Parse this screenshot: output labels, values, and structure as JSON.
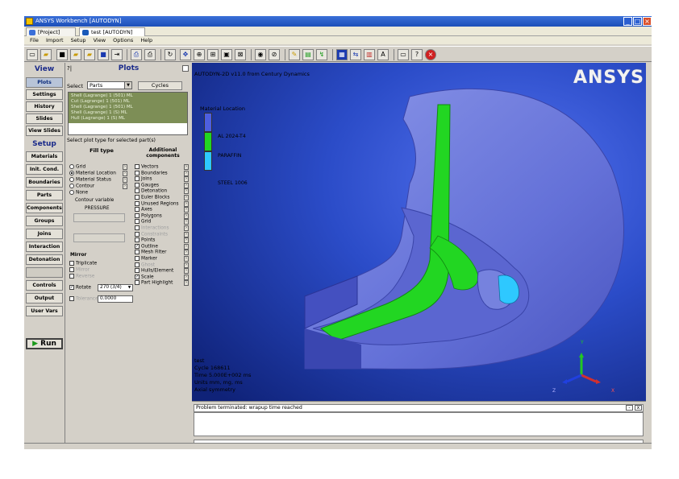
{
  "window": {
    "title": "ANSYS Workbench [AUTODYN]"
  },
  "tabs": [
    {
      "label": "[Project]"
    },
    {
      "label": "test [AUTODYN]"
    }
  ],
  "tab_close": "×",
  "menu": [
    "File",
    "Import",
    "Setup",
    "View",
    "Options",
    "Help"
  ],
  "left_nav": {
    "view_header": "View",
    "view_items": [
      {
        "label": "Plots"
      },
      {
        "label": "Settings"
      },
      {
        "label": "History"
      },
      {
        "label": "Slides"
      },
      {
        "label": "View Slides"
      }
    ],
    "setup_header": "Setup",
    "setup_items": [
      {
        "label": "Materials"
      },
      {
        "label": "Init. Cond."
      },
      {
        "label": "Boundaries"
      },
      {
        "label": "Parts"
      },
      {
        "label": "Components"
      },
      {
        "label": "Groups"
      },
      {
        "label": "Joins"
      },
      {
        "label": "Interaction"
      },
      {
        "label": "Detonation"
      },
      {
        "label": "Controls"
      },
      {
        "label": "Output"
      },
      {
        "label": "User Vars"
      }
    ],
    "run_label": "Run"
  },
  "plots_panel": {
    "title": "Plots",
    "select_label": "Select",
    "select_value": "Parts",
    "cycles_label": "Cycles",
    "parts_list": [
      "Shell (Lagrange) 1 (501) ML",
      "Cut (Lagrange) 1 (501) ML",
      "Shell (Lagrange) 1 (501) ML",
      "Shell (Lagrange) 1 (S) ML",
      "Hull (Lagrange) 1 (S) ML"
    ],
    "subtitle": "Select plot type for selected part(s)",
    "fill_type_header": "Fill type",
    "additional_header": "Additional components",
    "fill_types": [
      {
        "label": "Grid",
        "on": false
      },
      {
        "label": "Material Location",
        "on": true
      },
      {
        "label": "Material Status",
        "on": false
      },
      {
        "label": "Contour",
        "on": false
      },
      {
        "label": "None",
        "on": false
      }
    ],
    "contour_variable_label": "Contour variable",
    "contour_variable_value": "PRESSURE",
    "components": [
      {
        "label": "Vectors",
        "on": false
      },
      {
        "label": "Boundaries",
        "on": false
      },
      {
        "label": "Joins",
        "on": false
      },
      {
        "label": "Gauges",
        "on": false
      },
      {
        "label": "Detonation",
        "on": false
      },
      {
        "label": "Euler Blocks",
        "on": false
      },
      {
        "label": "Unused Regions",
        "on": false
      },
      {
        "label": "Axes",
        "on": false
      },
      {
        "label": "Polygons",
        "on": false
      },
      {
        "label": "Grid",
        "on": false
      },
      {
        "label": "Interactions",
        "on": false
      },
      {
        "label": "Constraints",
        "on": false
      },
      {
        "label": "Points",
        "on": false
      },
      {
        "label": "Outline",
        "on": true
      },
      {
        "label": "Mesh Filter",
        "on": false
      },
      {
        "label": "Marker",
        "on": false
      },
      {
        "label": "Ghost",
        "on": false
      },
      {
        "label": "Hulls/Element",
        "on": false
      },
      {
        "label": "Scale",
        "on": true
      },
      {
        "label": "Part Highlight",
        "on": false
      }
    ],
    "mirror_header": "Mirror",
    "mirror_items": [
      {
        "label": "Triplicate",
        "on": false
      },
      {
        "label": "Mirror",
        "on": false
      },
      {
        "label": "Reverse",
        "on": false
      }
    ],
    "rotate_label": "Rotate",
    "rotate_value": "270 (3/4)",
    "tolerance_label": "Tolerance",
    "tolerance_value": "0.0000"
  },
  "viewport": {
    "title": "AUTODYN-2D v11.0 from Century Dynamics",
    "logo": "ANSYS",
    "legend_title": "Material Location",
    "legend": [
      {
        "label": "AL 2024-T4",
        "color": "#4e5fe0"
      },
      {
        "label": "PARAFFIN",
        "color": "#22d622"
      },
      {
        "label": "STEEL 1006",
        "color": "#2ec8ff"
      }
    ],
    "info": [
      "test",
      "Cycle 168611",
      "Time 5.000E+002 ms",
      "Units mm, mg, ms",
      "Axial symmetry"
    ],
    "axis_labels": {
      "y": "Y",
      "x": "X",
      "z": "Z"
    }
  },
  "messages": {
    "header": "Problem terminated: wrapup time reached",
    "controls": [
      "-",
      "x"
    ]
  },
  "colors": {
    "accent": "#1a2a8a",
    "viewport_bg_dark": "#1f3ea8",
    "selection_green": "#7d8e56"
  }
}
